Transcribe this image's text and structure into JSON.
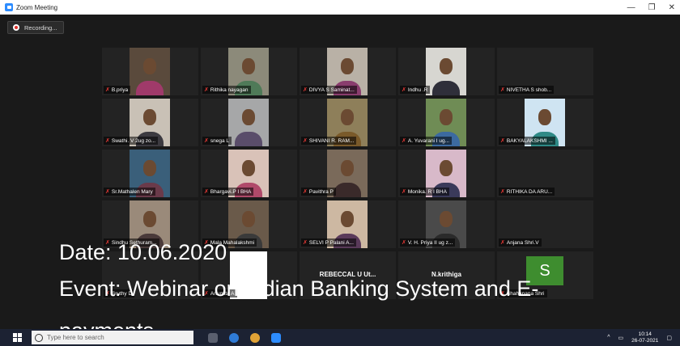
{
  "window": {
    "title": "Zoom Meeting",
    "minimize": "—",
    "maximize": "❐",
    "close": "✕"
  },
  "recording": {
    "label": "Recording..."
  },
  "participants": [
    {
      "name": "B.priya",
      "muted": true,
      "bg": "#5a4a3c",
      "shirt": "#a03a6a"
    },
    {
      "name": "Rithika nayagan",
      "muted": true,
      "bg": "#8c8a7a",
      "shirt": "#4f7a58"
    },
    {
      "name": "DIVYA S Saminat...",
      "muted": true,
      "bg": "#b9b1a6",
      "shirt": "#8a3d6e"
    },
    {
      "name": "Indhu .R",
      "muted": true,
      "bg": "#d7d6d1",
      "shirt": "#2f2f3a"
    },
    {
      "name": "NIVETHA S shob...",
      "muted": true,
      "bg": "",
      "shirt": ""
    },
    {
      "name": "Swathi. V 2ug zo...",
      "muted": true,
      "bg": "#c9c1b6",
      "shirt": "#3c3a40"
    },
    {
      "name": "snega L",
      "muted": true,
      "bg": "#a6a7a8",
      "shirt": "#5a4d6a"
    },
    {
      "name": "SHIVANI R. RAM...",
      "muted": true,
      "bg": "#8e7f5a",
      "shirt": "#7a5a2a"
    },
    {
      "name": "A. Yuvarani   I ug...",
      "muted": true,
      "bg": "#6f8c55",
      "shirt": "#3c6aa0"
    },
    {
      "name": "BAKYALAKSHMI ...",
      "muted": true,
      "bg": "#cfe4f2",
      "shirt": "#2f8a86"
    },
    {
      "name": "Sr.Mathalen Mary",
      "muted": true,
      "bg": "#3a5f7a",
      "shirt": "#6a3a4a"
    },
    {
      "name": "Bhargavi.P   I BHA",
      "muted": true,
      "bg": "#d9c2b8",
      "shirt": "#b04a6a"
    },
    {
      "name": "Pavithra P",
      "muted": true,
      "bg": "#7a6a5a",
      "shirt": "#3a2a2a"
    },
    {
      "name": "Monika. R I BHA",
      "muted": true,
      "bg": "#d8b9c9",
      "shirt": "#3a3a5a"
    },
    {
      "name": "RITHIKA DA ARU...",
      "muted": true,
      "bg": "",
      "shirt": ""
    },
    {
      "name": "Sindhu Sethuram...",
      "muted": true,
      "bg": "#9a8a7a",
      "shirt": "#4a3a3a"
    },
    {
      "name": "Mala Mahalakshmi",
      "muted": true,
      "bg": "#6a5a4a",
      "shirt": "#3a3a3a"
    },
    {
      "name": "SELVI P Palani A...",
      "muted": true,
      "bg": "#cdb8a2",
      "shirt": "#5a3a5a"
    },
    {
      "name": "V. H. Priya II ug z...",
      "muted": true,
      "bg": "#4a4a4a",
      "shirt": "#2a2a2a"
    },
    {
      "name": "Anjana Shri.V",
      "muted": true,
      "bg": "",
      "shirt": ""
    },
    {
      "name": "Sruthy D",
      "muted": true,
      "bg": "",
      "shirt": ""
    },
    {
      "name": "Anumita A",
      "muted": true,
      "bg": "#ffffff",
      "shirt": ""
    },
    {
      "name": "REBECCAL U Ut...",
      "muted": false,
      "bg": "",
      "shirt": "",
      "center": true
    },
    {
      "name": "N.krithiga",
      "muted": false,
      "bg": "",
      "shirt": "",
      "center": true
    },
    {
      "name": "Shahanana Shri",
      "muted": true,
      "bg": "",
      "shirt": "",
      "avatar": "S"
    }
  ],
  "overlay": {
    "date": "Date: 10.06.2020",
    "event_line1": "Event: Webinar on Indian Banking System and E-",
    "event_line2": "payments"
  },
  "taskbar": {
    "search_placeholder": "Type here to search",
    "time": "10:14",
    "date": "26-07-2021"
  }
}
